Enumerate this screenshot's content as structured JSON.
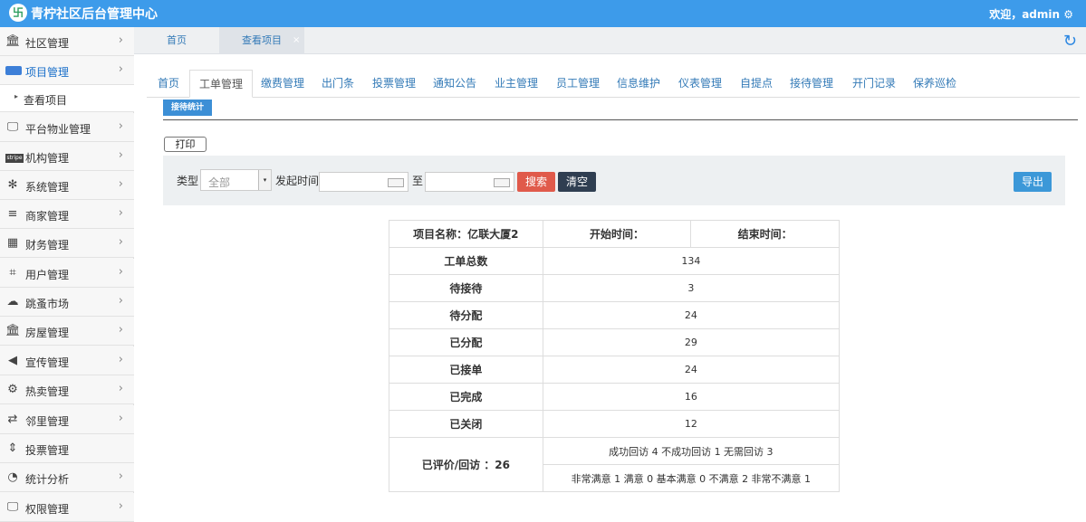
{
  "header": {
    "logo": "卐",
    "title": "青柠社区后台管理中心",
    "welcome": "欢迎，admin ⚙"
  },
  "sidebar": {
    "items": [
      {
        "label": "社区管理",
        "icon": "bank-icon",
        "glyph": "🏛"
      },
      {
        "label": "项目管理",
        "icon": "card-icon",
        "glyph": ""
      },
      {
        "label": "平台物业管理",
        "icon": "monitor-icon",
        "glyph": "🖵"
      },
      {
        "label": "机构管理",
        "icon": "stripe-icon",
        "glyph": ""
      },
      {
        "label": "系统管理",
        "icon": "yelp-icon",
        "glyph": "✻"
      },
      {
        "label": "商家管理",
        "icon": "bars-icon",
        "glyph": "≡"
      },
      {
        "label": "财务管理",
        "icon": "calculator-icon",
        "glyph": "▦"
      },
      {
        "label": "用户管理",
        "icon": "crop-icon",
        "glyph": "⌗"
      },
      {
        "label": "跳蚤市场",
        "icon": "cloud-icon",
        "glyph": "☁"
      },
      {
        "label": "房屋管理",
        "icon": "bank-icon",
        "glyph": "🏛"
      },
      {
        "label": "宣传管理",
        "icon": "volume-icon",
        "glyph": "◀"
      },
      {
        "label": "热卖管理",
        "icon": "gear-icon",
        "glyph": "⚙"
      },
      {
        "label": "邻里管理",
        "icon": "retweet-icon",
        "glyph": "⇄"
      },
      {
        "label": "投票管理",
        "icon": "sort-icon",
        "glyph": "⇕"
      },
      {
        "label": "统计分析",
        "icon": "pie-chart-icon",
        "glyph": "◔"
      },
      {
        "label": "权限管理",
        "icon": "desktop-icon",
        "glyph": "🖵"
      }
    ],
    "sub_item": "查看项目",
    "chevron": "›",
    "sub_marker": "▸"
  },
  "tabs": [
    {
      "label": "首页"
    },
    {
      "label": "查看项目"
    }
  ],
  "tab_close": "×",
  "refresh": "↻",
  "subtabs": [
    "首页",
    "工单管理",
    "缴费管理",
    "出门条",
    "投票管理",
    "通知公告",
    "业主管理",
    "员工管理",
    "信息维护",
    "仪表管理",
    "自提点",
    "接待管理",
    "开门记录",
    "保养巡检"
  ],
  "stat_button": "接待统计",
  "print_button": "打印",
  "filter": {
    "type_label": "类型",
    "type_value": "全部",
    "time_label": "发起时间",
    "to_label": "至",
    "search": "搜索",
    "clear": "清空",
    "export": "导出",
    "select_arrow": "▾"
  },
  "table": {
    "project": "项目名称：亿联大厦2",
    "start": "开始时间：",
    "end": "结束时间：",
    "rows": [
      {
        "k": "工单总数",
        "v": "134"
      },
      {
        "k": "待接待",
        "v": "3"
      },
      {
        "k": "待分配",
        "v": "24"
      },
      {
        "k": "已分配",
        "v": "29"
      },
      {
        "k": "已接单",
        "v": "24"
      },
      {
        "k": "已完成",
        "v": "16"
      },
      {
        "k": "已关闭",
        "v": "12"
      }
    ],
    "eval_label": "已评价/回访 ：26",
    "eval_row1": "成功回访 4 不成功回访 1 无需回访 3",
    "eval_row2": "非常满意 1 满意 0 基本满意 0 不满意 2 非常不满意 1"
  }
}
